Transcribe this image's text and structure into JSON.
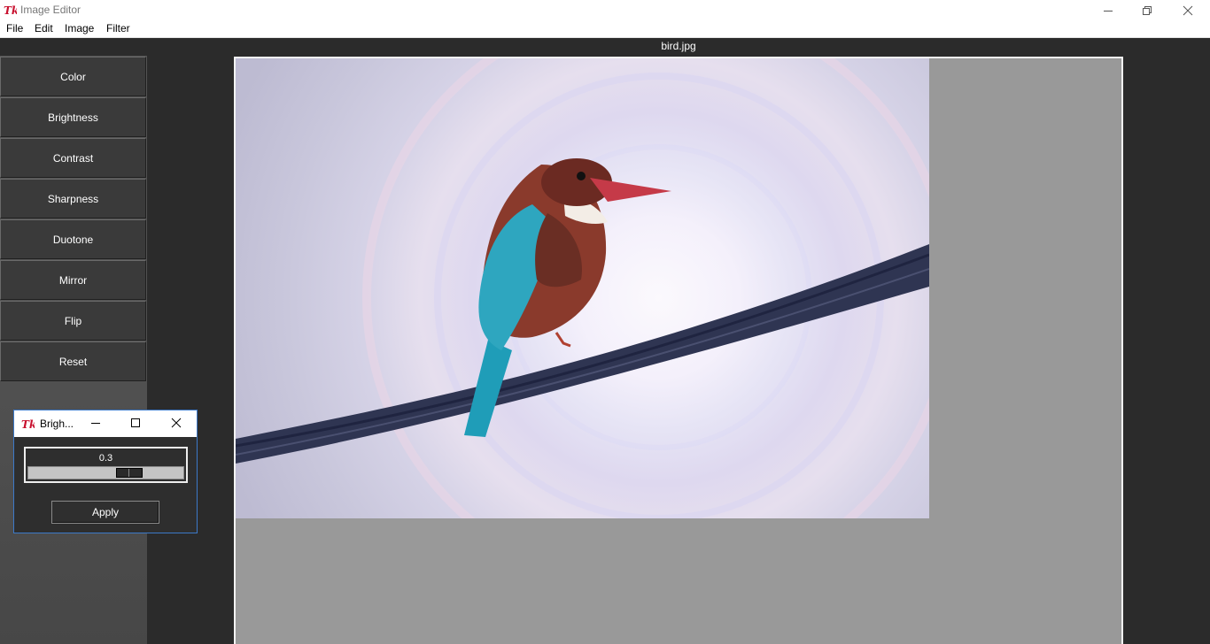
{
  "window": {
    "title": "Image Editor"
  },
  "menu": [
    {
      "label": "File"
    },
    {
      "label": "Edit"
    },
    {
      "label": "Image"
    },
    {
      "label": "Filter"
    }
  ],
  "toolbar": {
    "buttons": [
      {
        "label": "Color"
      },
      {
        "label": "Brightness"
      },
      {
        "label": "Contrast"
      },
      {
        "label": "Sharpness"
      },
      {
        "label": "Duotone"
      },
      {
        "label": "Mirror"
      },
      {
        "label": "Flip"
      },
      {
        "label": "Reset"
      }
    ]
  },
  "canvas": {
    "filename": "bird.jpg"
  },
  "dialog": {
    "title": "Brigh...",
    "scale_value": "0.3",
    "scale_fraction": 0.65,
    "apply_label": "Apply"
  },
  "icons": {
    "app": "tk-feather-icon",
    "minimize": "minimize-icon",
    "maximize": "restore-icon",
    "close": "close-icon"
  },
  "colors": {
    "canvas_background": "#999999",
    "sidebar_button": "#3a3a3a",
    "dialog_border": "#3c79c8",
    "tk_logo": "#c8102e"
  }
}
